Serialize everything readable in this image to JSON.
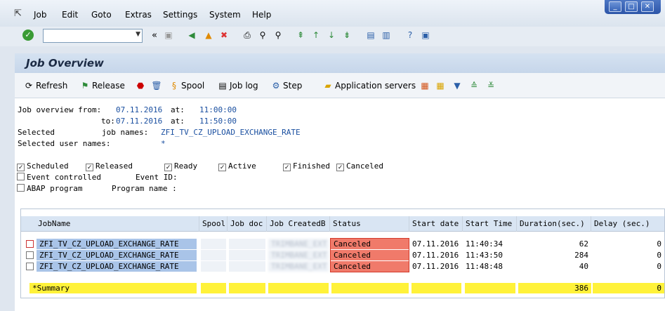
{
  "menu": {
    "items": [
      "Job",
      "Edit",
      "Goto",
      "Extras",
      "Settings",
      "System",
      "Help"
    ]
  },
  "window_controls": {
    "minimize": "_",
    "maximize": "□",
    "close": "✕"
  },
  "toolbar": {
    "command_field_value": "",
    "back_glyph": "«"
  },
  "page": {
    "title": "Job Overview"
  },
  "app_toolbar": {
    "refresh": "Refresh",
    "release": "Release",
    "spool": "Spool",
    "job_log": "Job log",
    "step": "Step",
    "application_servers": "Application servers"
  },
  "criteria": {
    "from_label": "Job overview from:",
    "from_date": "07.11.2016",
    "at_label_1": "at:",
    "from_time": "11:00:00",
    "to_label": "to:",
    "to_date": "07.11.2016",
    "at_label_2": "at:",
    "to_time": "11:50:00",
    "selected_label": "Selected",
    "job_names_label": "job names:",
    "job_names": "ZFI_TV_CZ_UPLOAD_EXCHANGE_RATE",
    "user_names_label": "Selected user names:",
    "user_names": "*"
  },
  "status_filters": {
    "scheduled": "Scheduled",
    "released": "Released",
    "ready": "Ready",
    "active": "Active",
    "finished": "Finished",
    "canceled": "Canceled",
    "event_controlled": "Event controlled",
    "event_id_label": "Event ID:",
    "abap_program": "ABAP program",
    "program_name_label": "Program name :"
  },
  "table": {
    "headers": {
      "jobname": "JobName",
      "spool": "Spool",
      "job_doc": "Job doc",
      "created_by": "Job CreatedB",
      "status": "Status",
      "start_date": "Start date",
      "start_time": "Start Time",
      "duration": "Duration(sec.)",
      "delay": "Delay (sec.)"
    },
    "rows": [
      {
        "jobname": "ZFI_TV_CZ_UPLOAD_EXCHANGE_RATE",
        "created_by": "TRIMBANE_EXT",
        "status": "Canceled",
        "start_date": "07.11.2016",
        "start_time": "11:40:34",
        "duration": "62",
        "delay": "0"
      },
      {
        "jobname": "ZFI_TV_CZ_UPLOAD_EXCHANGE_RATE",
        "created_by": "TRIMBANE_EXT",
        "status": "Canceled",
        "start_date": "07.11.2016",
        "start_time": "11:43:50",
        "duration": "284",
        "delay": "0"
      },
      {
        "jobname": "ZFI_TV_CZ_UPLOAD_EXCHANGE_RATE",
        "created_by": "TRIMBANE_EXT",
        "status": "Canceled",
        "start_date": "07.11.2016",
        "start_time": "11:48:48",
        "duration": "40",
        "delay": "0"
      }
    ],
    "summary": {
      "label": "*Summary",
      "duration": "386",
      "delay": "0"
    }
  },
  "colors": {
    "canceled_bg": "#f07a6a",
    "summary_bg": "#fff23a",
    "selected_row_bg": "#a9c4e8",
    "header_bg": "#d9e5f3"
  }
}
